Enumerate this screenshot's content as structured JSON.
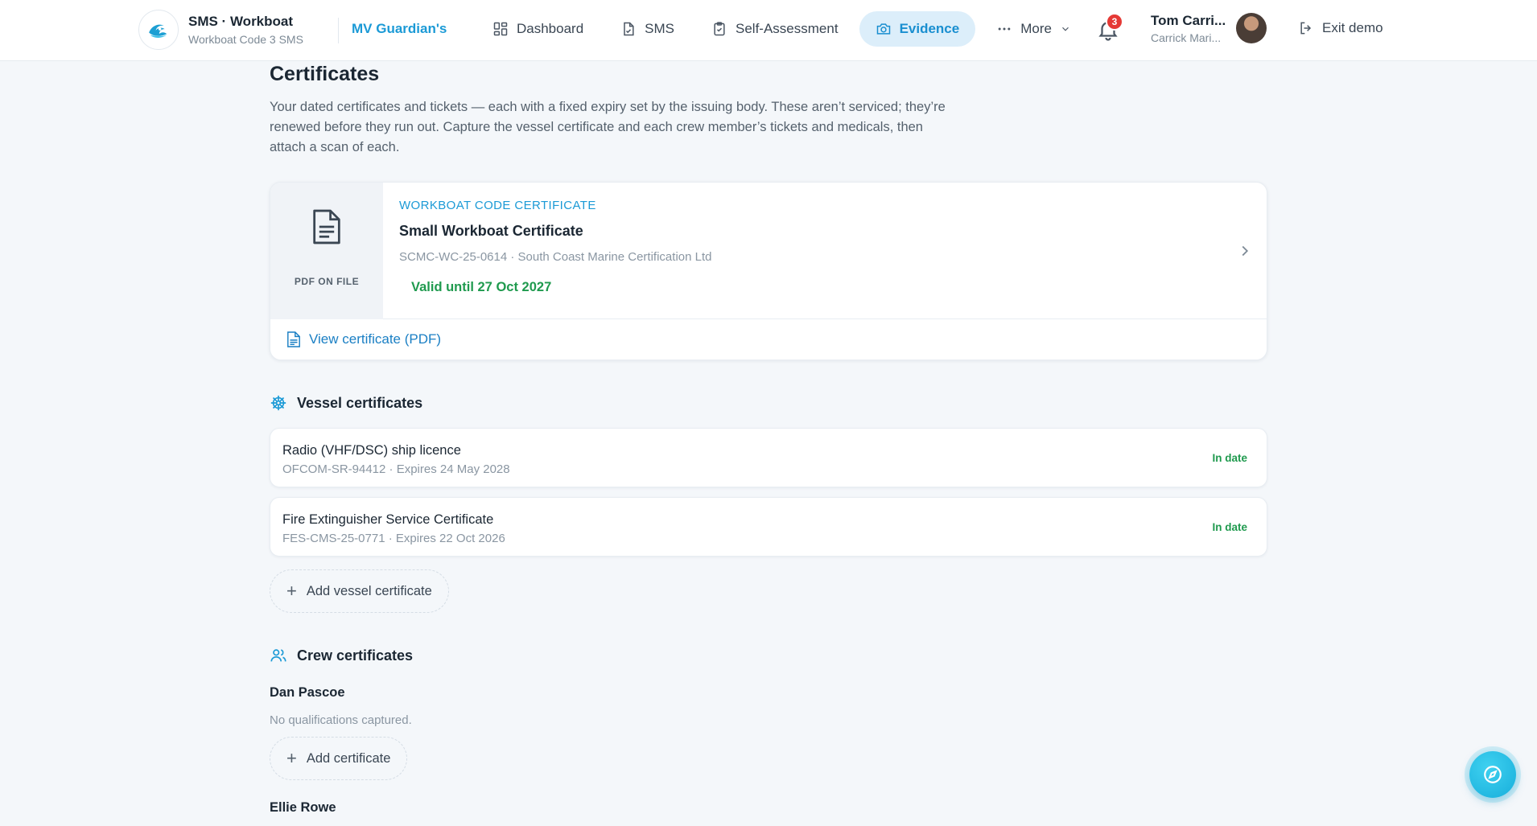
{
  "brand": {
    "title": "SMS · Workboat",
    "subtitle": "Workboat Code 3 SMS",
    "vessel": "MV Guardian's"
  },
  "nav": [
    {
      "label": "Dashboard",
      "icon": "grid-icon"
    },
    {
      "label": "SMS",
      "icon": "document-icon"
    },
    {
      "label": "Self-Assessment",
      "icon": "clipboard-check-icon"
    },
    {
      "label": "Evidence",
      "icon": "camera-icon",
      "active": true
    },
    {
      "label": "More",
      "icon": "dots-icon"
    }
  ],
  "notifications": {
    "count": "3"
  },
  "user": {
    "name": "Tom Carri...",
    "org": "Carrick Mari..."
  },
  "exit_label": "Exit demo",
  "page": {
    "title": "Certificates",
    "description": "Your dated certificates and tickets — each with a fixed expiry set by the issuing body. These aren’t serviced; they’re renewed before they run out. Capture the vessel certificate and each crew member’s tickets and medicals, then attach a scan of each."
  },
  "main_certificate": {
    "thumb_label": "PDF ON FILE",
    "kicker": "WORKBOAT CODE CERTIFICATE",
    "title": "Small Workboat Certificate",
    "meta": "SCMC-WC-25-0614 · South Coast Marine Certification Ltd",
    "valid": "Valid until 27 Oct 2027",
    "view_label": "View certificate (PDF)"
  },
  "vessel_section": {
    "title": "Vessel certificates",
    "items": [
      {
        "title": "Radio (VHF/DSC) ship licence",
        "meta": "OFCOM-SR-94412 · Expires 24 May 2028",
        "status": "In date"
      },
      {
        "title": "Fire Extinguisher Service Certificate",
        "meta": "FES-CMS-25-0771 · Expires 22 Oct 2026",
        "status": "In date"
      }
    ],
    "add_label": "Add vessel certificate"
  },
  "crew_section": {
    "title": "Crew certificates",
    "members": [
      {
        "name": "Dan Pascoe",
        "empty": "No qualifications captured.",
        "add_label": "Add certificate"
      },
      {
        "name": "Ellie Rowe"
      }
    ]
  },
  "colors": {
    "accent": "#1b9ad6",
    "success": "#1f9a4e",
    "badge": "#e53935"
  }
}
